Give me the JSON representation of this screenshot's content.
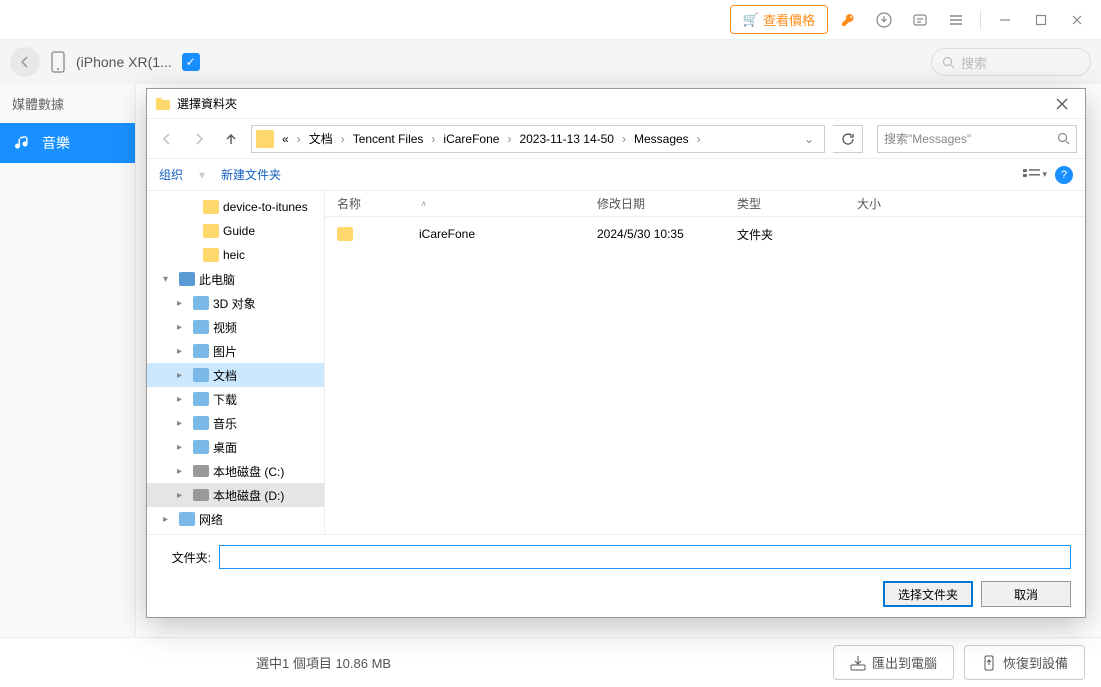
{
  "titlebar": {
    "price_label": "查看價格"
  },
  "devicebar": {
    "device_name": "(iPhone XR(1...",
    "search_placeholder": "搜索"
  },
  "sidebar": {
    "header": "媒體數據",
    "music_label": "音樂"
  },
  "bottombar": {
    "status": "選中1 個項目 10.86 MB",
    "export_label": "匯出到電腦",
    "restore_label": "恢復到設備"
  },
  "dialog": {
    "title": "選擇資料夾",
    "breadcrumb": [
      "«",
      "文档",
      "Tencent Files",
      "iCareFone",
      "2023-11-13 14-50",
      "Messages"
    ],
    "search_placeholder": "搜索\"Messages\"",
    "toolbar": {
      "organize": "组织",
      "new_folder": "新建文件夹"
    },
    "columns": {
      "name": "名称",
      "date": "修改日期",
      "type": "类型",
      "size": "大小"
    },
    "tree": [
      {
        "label": "device-to-itunes",
        "indent": 28,
        "icon": "folder"
      },
      {
        "label": "Guide",
        "indent": 28,
        "icon": "folder"
      },
      {
        "label": "heic",
        "indent": 28,
        "icon": "folder"
      },
      {
        "label": "此电脑",
        "indent": 4,
        "icon": "pc",
        "chevron": "▾"
      },
      {
        "label": "3D 对象",
        "indent": 18,
        "icon": "generic",
        "chevron": "▸"
      },
      {
        "label": "视频",
        "indent": 18,
        "icon": "generic",
        "chevron": "▸"
      },
      {
        "label": "图片",
        "indent": 18,
        "icon": "generic",
        "chevron": "▸"
      },
      {
        "label": "文档",
        "indent": 18,
        "icon": "generic",
        "chevron": "▸",
        "selected": true
      },
      {
        "label": "下载",
        "indent": 18,
        "icon": "generic",
        "chevron": "▸"
      },
      {
        "label": "音乐",
        "indent": 18,
        "icon": "generic",
        "chevron": "▸"
      },
      {
        "label": "桌面",
        "indent": 18,
        "icon": "generic",
        "chevron": "▸"
      },
      {
        "label": "本地磁盘 (C:)",
        "indent": 18,
        "icon": "disk",
        "chevron": "▸"
      },
      {
        "label": "本地磁盘 (D:)",
        "indent": 18,
        "icon": "disk",
        "chevron": "▸",
        "highlight": true
      },
      {
        "label": "网络",
        "indent": 4,
        "icon": "generic",
        "chevron": "▸"
      }
    ],
    "files": [
      {
        "name": "iCareFone",
        "date": "2024/5/30 10:35",
        "type": "文件夹",
        "size": ""
      }
    ],
    "folder_label": "文件夹:",
    "select_btn": "选择文件夹",
    "cancel_btn": "取消"
  }
}
